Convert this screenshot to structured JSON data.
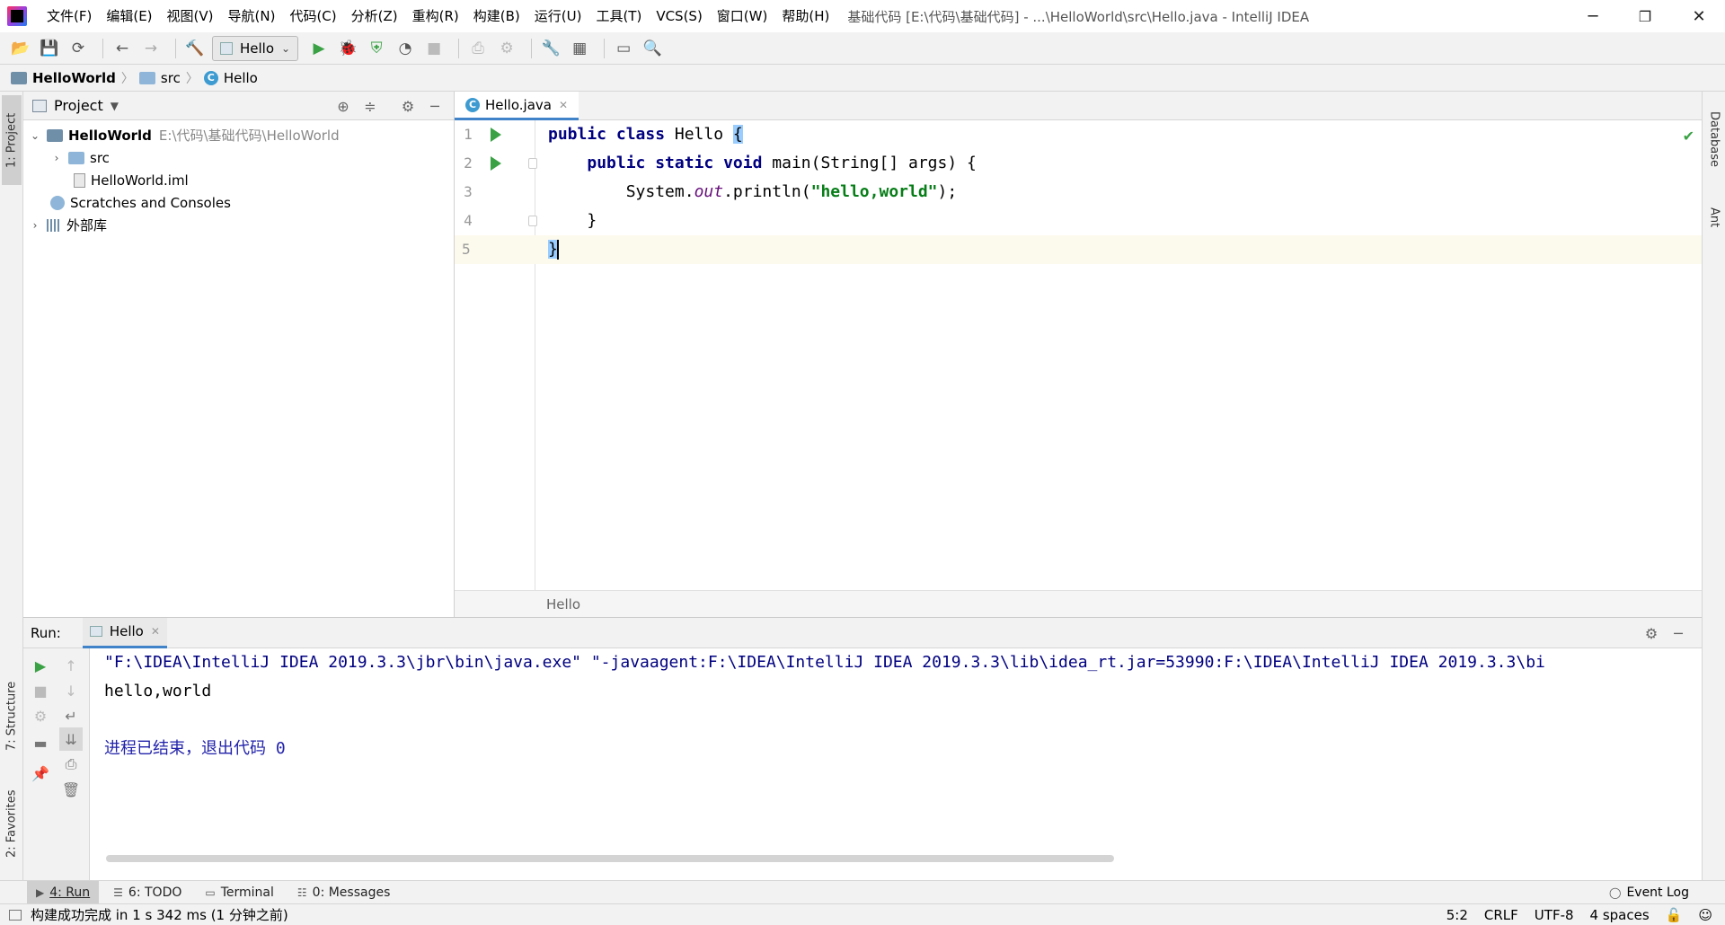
{
  "window": {
    "title": "基础代码 [E:\\代码\\基础代码] - ...\\HelloWorld\\src\\Hello.java - IntelliJ IDEA",
    "minimize": "─",
    "restore": "❐",
    "close": "✕"
  },
  "menu": [
    "文件(F)",
    "编辑(E)",
    "视图(V)",
    "导航(N)",
    "代码(C)",
    "分析(Z)",
    "重构(R)",
    "构建(B)",
    "运行(U)",
    "工具(T)",
    "VCS(S)",
    "窗口(W)",
    "帮助(H)"
  ],
  "toolbar": {
    "run_config": "Hello",
    "icons": [
      "open-folder-icon",
      "save-icon",
      "sync-icon",
      "back-icon",
      "forward-icon",
      "build-icon",
      "run-icon",
      "debug-icon",
      "coverage-icon",
      "profile-icon",
      "stop-icon",
      "attach-icon",
      "project-structure-icon",
      "settings-icon",
      "sdk-icon",
      "terminal-icon",
      "search-icon"
    ]
  },
  "breadcrumb": {
    "project": "HelloWorld",
    "folder": "src",
    "class": "Hello"
  },
  "left_stripe": {
    "project": "1: Project",
    "structure": "7: Structure",
    "favorites": "2: Favorites"
  },
  "right_stripe": {
    "database": "Database",
    "ant": "Ant"
  },
  "project_panel": {
    "title": "Project",
    "tree": {
      "root_name": "HelloWorld",
      "root_path": "E:\\代码\\基础代码\\HelloWorld",
      "src": "src",
      "iml": "HelloWorld.iml",
      "scratches": "Scratches and Consoles",
      "external": "外部库"
    }
  },
  "editor": {
    "tab": "Hello.java",
    "line_numbers": [
      "1",
      "2",
      "3",
      "4",
      "5"
    ],
    "breadcrumb_footer": "Hello",
    "code": {
      "l1_kw": "public class",
      "l1_name": " Hello ",
      "l1_brace": "{",
      "l2_indent": "    ",
      "l2_kw": "public static void",
      "l2_rest": " main(String[] args) {",
      "l3_pre": "        System.",
      "l3_field": "out",
      "l3_mid": ".println(",
      "l3_str": "\"hello,world\"",
      "l3_end": ");",
      "l4": "    }",
      "l5": "}"
    }
  },
  "run_panel": {
    "label": "Run:",
    "tab": "Hello",
    "console": {
      "cmd": "\"F:\\IDEA\\IntelliJ IDEA 2019.3.3\\jbr\\bin\\java.exe\" \"-javaagent:F:\\IDEA\\IntelliJ IDEA 2019.3.3\\lib\\idea_rt.jar=53990:F:\\IDEA\\IntelliJ IDEA 2019.3.3\\bi",
      "output": "hello,world",
      "exit": "进程已结束，退出代码 0"
    }
  },
  "bottom_bar": {
    "run": "4: Run",
    "todo": "6: TODO",
    "terminal": "Terminal",
    "messages": "0: Messages",
    "event_log": "Event Log"
  },
  "status": {
    "message": "构建成功完成 in 1 s 342 ms (1 分钟之前)",
    "position": "5:2",
    "line_sep": "CRLF",
    "encoding": "UTF-8",
    "indent": "4 spaces"
  }
}
